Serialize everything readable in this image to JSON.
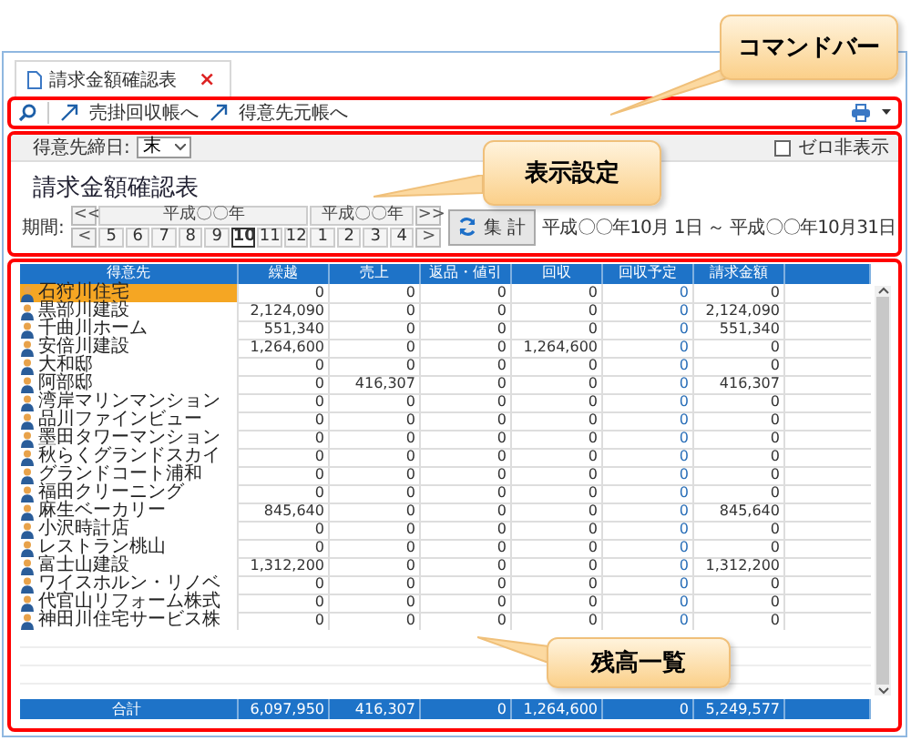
{
  "tab": {
    "title": "請求金額確認表",
    "close": "×"
  },
  "command_bar": {
    "links": [
      "売掛回収帳へ",
      "得意先元帳へ"
    ]
  },
  "filter": {
    "label": "得意先締日:",
    "value": "末",
    "zero_hide": {
      "label": "ゼロ非表示",
      "checked": false
    }
  },
  "report_title": "請求金額確認表",
  "period": {
    "label": "期間:",
    "first": "<<",
    "prev": "<",
    "next": ">",
    "last": ">>",
    "years": [
      {
        "label": "平成〇〇年",
        "months": [
          {
            "label": "5",
            "selected": false
          },
          {
            "label": "6",
            "selected": false
          },
          {
            "label": "7",
            "selected": false
          },
          {
            "label": "8",
            "selected": false
          },
          {
            "label": "9",
            "selected": false
          },
          {
            "label": "10",
            "selected": true
          },
          {
            "label": "11",
            "selected": false
          },
          {
            "label": "12",
            "selected": false
          }
        ]
      },
      {
        "label": "平成〇〇年",
        "months": [
          {
            "label": "1",
            "selected": false
          },
          {
            "label": "2",
            "selected": false
          },
          {
            "label": "3",
            "selected": false
          },
          {
            "label": "4",
            "selected": false
          }
        ]
      }
    ],
    "aggregate_button": "集 計",
    "range": "平成〇〇年10月 1日 ～ 平成〇〇年10月31日"
  },
  "table": {
    "columns": [
      {
        "label": "得意先",
        "highlight": false
      },
      {
        "label": "繰越",
        "highlight": false
      },
      {
        "label": "売上",
        "highlight": false
      },
      {
        "label": "返品・値引",
        "highlight": false
      },
      {
        "label": "回収",
        "highlight": false
      },
      {
        "label": "回収予定",
        "highlight": true
      },
      {
        "label": "請求金額",
        "highlight": false
      }
    ],
    "rows": [
      {
        "name": "石狩川住宅",
        "selected": true,
        "values": [
          "0",
          "0",
          "0",
          "0",
          "0",
          "0"
        ]
      },
      {
        "name": "黒部川建設",
        "selected": false,
        "values": [
          "2,124,090",
          "0",
          "0",
          "0",
          "0",
          "2,124,090"
        ]
      },
      {
        "name": "千曲川ホーム",
        "selected": false,
        "values": [
          "551,340",
          "0",
          "0",
          "0",
          "0",
          "551,340"
        ]
      },
      {
        "name": "安倍川建設",
        "selected": false,
        "values": [
          "1,264,600",
          "0",
          "0",
          "1,264,600",
          "0",
          "0"
        ]
      },
      {
        "name": "大和邸",
        "selected": false,
        "values": [
          "0",
          "0",
          "0",
          "0",
          "0",
          "0"
        ]
      },
      {
        "name": "阿部邸",
        "selected": false,
        "values": [
          "0",
          "416,307",
          "0",
          "0",
          "0",
          "416,307"
        ]
      },
      {
        "name": "湾岸マリンマンション",
        "selected": false,
        "values": [
          "0",
          "0",
          "0",
          "0",
          "0",
          "0"
        ]
      },
      {
        "name": "品川ファインビュー",
        "selected": false,
        "values": [
          "0",
          "0",
          "0",
          "0",
          "0",
          "0"
        ]
      },
      {
        "name": "墨田タワーマンション",
        "selected": false,
        "values": [
          "0",
          "0",
          "0",
          "0",
          "0",
          "0"
        ]
      },
      {
        "name": "秋らくグランドスカイ",
        "selected": false,
        "values": [
          "0",
          "0",
          "0",
          "0",
          "0",
          "0"
        ]
      },
      {
        "name": "グランドコート浦和",
        "selected": false,
        "values": [
          "0",
          "0",
          "0",
          "0",
          "0",
          "0"
        ]
      },
      {
        "name": "福田クリーニング",
        "selected": false,
        "values": [
          "0",
          "0",
          "0",
          "0",
          "0",
          "0"
        ]
      },
      {
        "name": "麻生ベーカリー",
        "selected": false,
        "values": [
          "845,640",
          "0",
          "0",
          "0",
          "0",
          "845,640"
        ]
      },
      {
        "name": "小沢時計店",
        "selected": false,
        "values": [
          "0",
          "0",
          "0",
          "0",
          "0",
          "0"
        ]
      },
      {
        "name": "レストラン桃山",
        "selected": false,
        "values": [
          "0",
          "0",
          "0",
          "0",
          "0",
          "0"
        ]
      },
      {
        "name": "富士山建設",
        "selected": false,
        "values": [
          "1,312,200",
          "0",
          "0",
          "0",
          "0",
          "1,312,200"
        ]
      },
      {
        "name": "ワイスホルン・リノベ",
        "selected": false,
        "values": [
          "0",
          "0",
          "0",
          "0",
          "0",
          "0"
        ]
      },
      {
        "name": "代官山リフォーム株式",
        "selected": false,
        "values": [
          "0",
          "0",
          "0",
          "0",
          "0",
          "0"
        ]
      },
      {
        "name": "神田川住宅サービス株",
        "selected": false,
        "values": [
          "0",
          "0",
          "0",
          "0",
          "0",
          "0"
        ]
      }
    ],
    "totals": {
      "label": "合計",
      "values": [
        "6,097,950",
        "416,307",
        "0",
        "1,264,600",
        "0",
        "5,249,577"
      ]
    }
  },
  "callouts": [
    "コマンドバー",
    "表示設定",
    "残高一覧"
  ]
}
